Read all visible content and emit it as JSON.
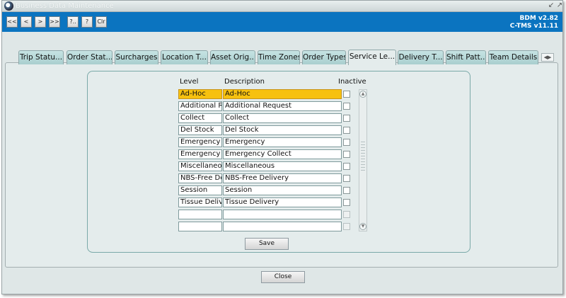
{
  "window": {
    "title": "Business Data Maintenance"
  },
  "toolbar": {
    "buttons": [
      "<<",
      "<",
      ">",
      ">>",
      "?..",
      "?",
      "Clr"
    ],
    "version_line1": "BDM v2.82",
    "version_line2": "C-TMS v11.11"
  },
  "tabs": [
    "Trip Statu...",
    "Order Stat...",
    "Surcharges",
    "Location T...",
    "Asset Orig...",
    "Time Zones",
    "Order Types",
    "Service Le...",
    "Delivery T...",
    "Shift Patt...",
    "Team Details"
  ],
  "active_tab": "Service Le...",
  "grid": {
    "headers": {
      "level": "Level",
      "description": "Description",
      "inactive": "Inactive"
    },
    "rows": [
      {
        "level": "Ad-Hoc",
        "description": "Ad-Hoc",
        "inactive": false,
        "selected": true
      },
      {
        "level": "Additional Re",
        "description": "Additional Request",
        "inactive": false
      },
      {
        "level": "Collect",
        "description": "Collect",
        "inactive": false
      },
      {
        "level": "Del Stock",
        "description": "Del Stock",
        "inactive": false
      },
      {
        "level": "Emergency",
        "description": "Emergency",
        "inactive": false
      },
      {
        "level": "Emergency C",
        "description": "Emergency Collect",
        "inactive": false
      },
      {
        "level": "Miscellaneou",
        "description": "Miscellaneous",
        "inactive": false
      },
      {
        "level": "NBS-Free De",
        "description": "NBS-Free Delivery",
        "inactive": false
      },
      {
        "level": "Session",
        "description": "Session",
        "inactive": false
      },
      {
        "level": "Tissue Delive",
        "description": "Tissue Delivery",
        "inactive": false
      },
      {
        "level": "",
        "description": "",
        "inactive": false,
        "empty": true
      },
      {
        "level": "",
        "description": "",
        "inactive": false,
        "empty": true
      }
    ]
  },
  "buttons": {
    "save": "Save",
    "close": "Close"
  },
  "colors": {
    "toolbar": "#0b74c0",
    "selected_row": "#f7c10f",
    "tab": "#b6d8d8",
    "panel": "#e4ecec"
  }
}
